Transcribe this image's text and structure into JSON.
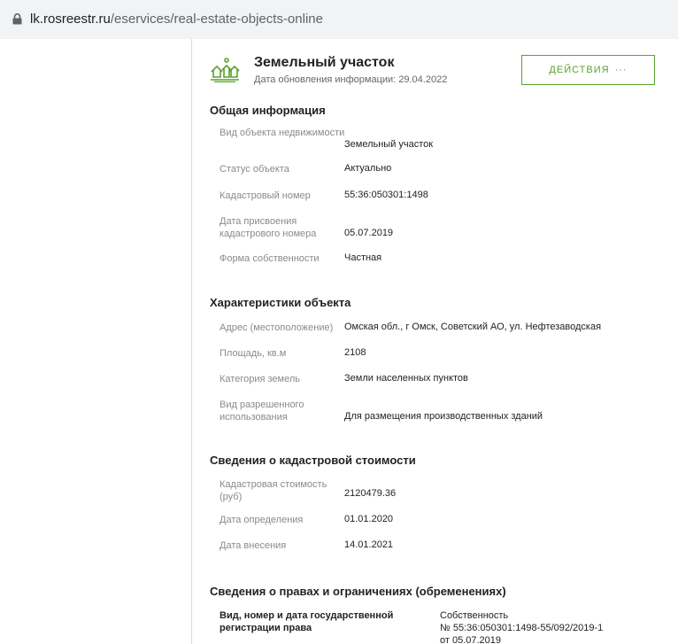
{
  "browser": {
    "url_host": "lk.rosreestr.ru",
    "url_path": "/eservices/real-estate-objects-online",
    "icons": {
      "lock": "lock-icon"
    }
  },
  "object": {
    "icon": "land-plot-icon",
    "title": "Земельный участок",
    "updated": "Дата обновления информации: 29.04.2022",
    "actions_label": "действия",
    "actions_dots": "···",
    "accent_color": "#5aa12e"
  },
  "general": {
    "title": "Общая информация",
    "rows": [
      {
        "label": "Вид объекта недвижимости",
        "value": "Земельный участок"
      },
      {
        "label": "Статус объекта",
        "value": "Актуально"
      },
      {
        "label": "Кадастровый номер",
        "value": "55:36:050301:1498"
      },
      {
        "label": "Дата присвоения кадастрового номера",
        "value": "05.07.2019"
      },
      {
        "label": "Форма собственности",
        "value": "Частная"
      }
    ]
  },
  "characteristics": {
    "title": "Характеристики объекта",
    "rows": [
      {
        "label": "Адрес (местоположение)",
        "value": "Омская обл., г Омск, Советский АО, ул. Нефтезаводская"
      },
      {
        "label": "Площадь, кв.м",
        "value": "2108"
      },
      {
        "label": "Категория земель",
        "value": "Земли населенных пунктов"
      },
      {
        "label": "Вид разрешенного использования",
        "value": "Для размещения производственных зданий"
      }
    ]
  },
  "cadastral_value": {
    "title": "Сведения о кадастровой стоимости",
    "rows": [
      {
        "label": "Кадастровая стоимость (руб)",
        "value": "2120479.36"
      },
      {
        "label": "Дата определения",
        "value": "01.01.2020"
      },
      {
        "label": "Дата внесения",
        "value": "14.01.2021"
      }
    ]
  },
  "rights": {
    "title": "Сведения о правах и ограничениях (обременениях)",
    "label": "Вид, номер и дата государственной регистрации права",
    "value_line1": "Собственность",
    "value_line2": "№ 55:36:050301:1498-55/092/2019-1",
    "value_line3": "от 05.07.2019"
  }
}
